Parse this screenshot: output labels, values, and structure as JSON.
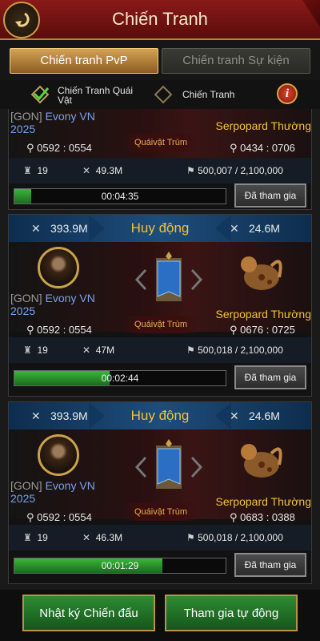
{
  "header": {
    "title": "Chiến Tranh"
  },
  "tabs": {
    "pvp": "Chiến tranh PvP",
    "event": "Chiến tranh Sự kiện"
  },
  "filters": {
    "monster": "Chiến Tranh Quái Vật",
    "war": "Chiến Tranh",
    "monster_checked": true,
    "war_checked": false
  },
  "cards": [
    {
      "player_guild": "[GON]",
      "player_name": "Evony VN 2025",
      "player_coord": "0592 : 0554",
      "boss_label": "Quáivật Trùm",
      "boss_name": "Serpopard Thường",
      "boss_coord": "0434 : 0706",
      "troops": "19",
      "power": "49.3M",
      "rally": "500,007 / 2,100,000",
      "timer": "00:04:35",
      "progress": 0.08,
      "button": "Đã tham gia"
    },
    {
      "mob_title": "Huy động",
      "left_power": "393.9M",
      "right_power": "24.6M",
      "player_guild": "[GON]",
      "player_name": "Evony VN 2025",
      "player_coord": "0592 : 0554",
      "boss_label": "Quáivật Trùm",
      "boss_name": "Serpopard Thường",
      "boss_coord": "0676 : 0725",
      "troops": "19",
      "power": "47M",
      "rally": "500,018 / 2,100,000",
      "timer": "00:02:44",
      "progress": 0.45,
      "button": "Đã tham gia"
    },
    {
      "mob_title": "Huy động",
      "left_power": "393.9M",
      "right_power": "24.6M",
      "player_guild": "[GON]",
      "player_name": "Evony VN 2025",
      "player_coord": "0592 : 0554",
      "boss_label": "Quáivật Trùm",
      "boss_name": "Serpopard Thường",
      "boss_coord": "0683 : 0388",
      "troops": "19",
      "power": "46.3M",
      "rally": "500,018 / 2,100,000",
      "timer": "00:01:29",
      "progress": 0.7,
      "button": "Đã tham gia"
    }
  ],
  "footer": {
    "log": "Nhật ký Chiến đấu",
    "auto": "Tham gia tự động"
  },
  "colors": {
    "header": "#7a1614",
    "gold": "#f0c23a",
    "player": "#7aa0e8",
    "progress": "#39b73a",
    "footer_btn": "#2f8a34"
  }
}
